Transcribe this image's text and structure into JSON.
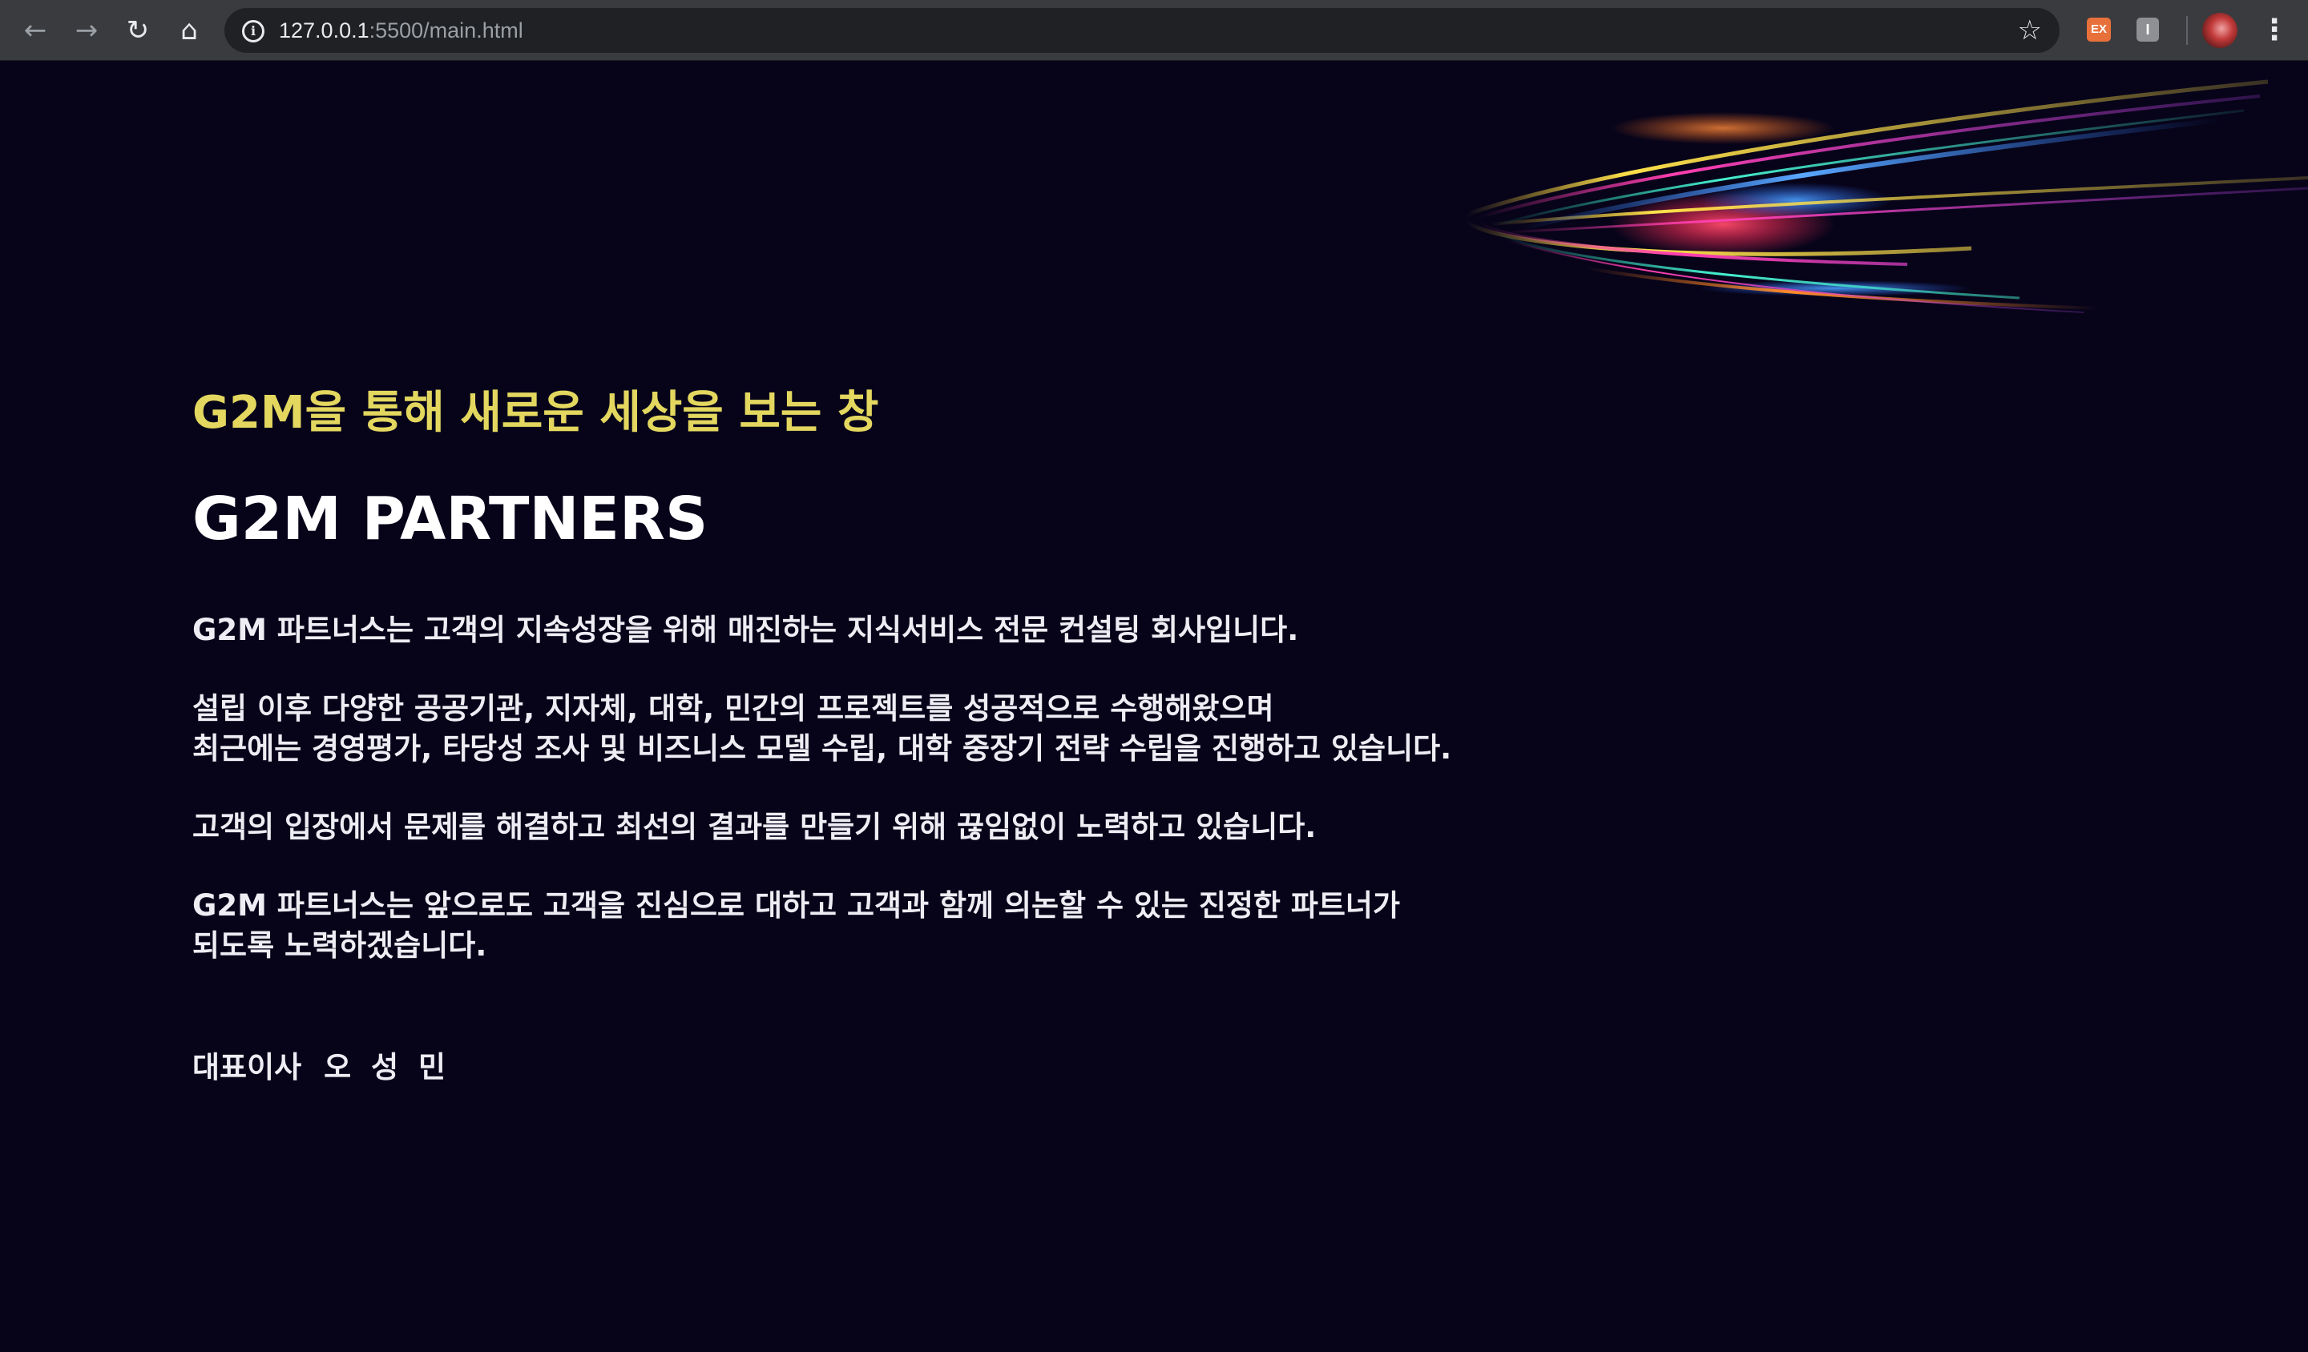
{
  "browser": {
    "url_host": "127.0.0.1",
    "url_path": ":5500/main.html",
    "extensions": [
      "EX",
      "I"
    ],
    "icons": [
      "back-icon",
      "forward-icon",
      "reload-icon",
      "home-icon",
      "info-icon",
      "star-icon",
      "menu-icon"
    ]
  },
  "hero": {
    "tagline": "G2M을 통해 새로운 세상을 보는 창",
    "company": "G2M PARTNERS",
    "paragraphs": [
      [
        "G2M 파트너스는 고객의 지속성장을 위해 매진하는 지식서비스 전문 컨설팅 회사입니다."
      ],
      [
        "설립 이후 다양한 공공기관, 지자체, 대학, 민간의 프로젝트를 성공적으로 수행해왔으며",
        "최근에는 경영평가, 타당성 조사 및 비즈니스 모델 수립, 대학 중장기 전략 수립을 진행하고 있습니다."
      ],
      [
        "고객의 입장에서 문제를 해결하고 최선의 결과를 만들기 위해 끊임없이 노력하고 있습니다."
      ],
      [
        "G2M 파트너스는 앞으로도 고객을 진심으로 대하고 고객과 함께 의논할 수 있는 진정한 파트너가",
        "되도록 노력하겠습니다."
      ]
    ],
    "signature_title": "대표이사",
    "signature_name": "오 성 민"
  },
  "colors": {
    "background": "#07041a",
    "tagline": "#e3d75f",
    "text": "#ededf3"
  }
}
